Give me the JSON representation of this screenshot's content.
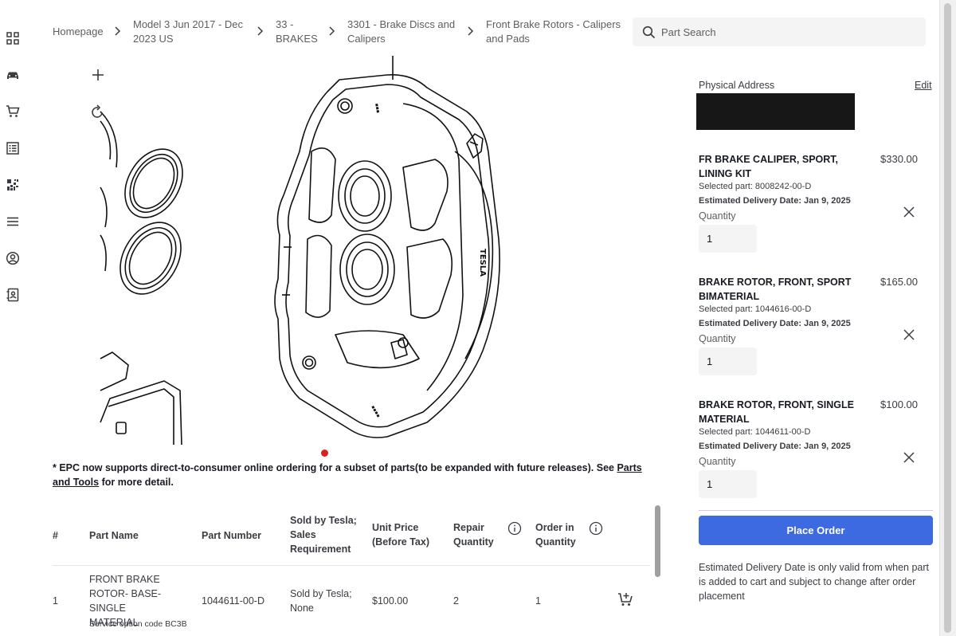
{
  "rail": {
    "items": [
      "grid-icon",
      "car-icon",
      "cart-icon",
      "catalog-icon",
      "qr-code-icon",
      "menu-icon",
      "account-icon",
      "contacts-icon"
    ]
  },
  "breadcrumb": {
    "items": [
      {
        "label": "Homepage"
      },
      {
        "label": "Model 3 Jun 2017 - Dec 2023 US"
      },
      {
        "label": "33 - BRAKES"
      },
      {
        "label": "3301 - Brake Discs and Calipers"
      },
      {
        "label": "Front Brake Rotors - Calipers and Pads"
      }
    ]
  },
  "search": {
    "placeholder": "Part Search"
  },
  "diagram": {
    "brand_mark": "TESLA"
  },
  "epc_note": {
    "text": "* EPC now supports direct-to-consumer online ordering for a subset of parts(to be expanded with future releases). See ",
    "link": "Parts and Tools",
    "suffix": " for more detail."
  },
  "table": {
    "headers": [
      "#",
      "Part Name",
      "Part Number",
      "Sold by Tesla; Sales Requirement",
      "Unit Price (Before Tax)",
      "Repair Quantity",
      "Order in Quantity"
    ],
    "rows": [
      {
        "index": "1",
        "part_name": "FRONT BRAKE ROTOR- BASE- SINGLE MATERIAL",
        "service_code": "Service option code BC3B",
        "part_number": "1044611-00-D",
        "sold_by": "Sold by Tesla; None",
        "unit_price": "$100.00",
        "repair_qty": "2",
        "order_qty": "1"
      }
    ]
  },
  "cart": {
    "physical_address_label": "Physical Address",
    "edit_label": "Edit",
    "quantity_label": "Quantity",
    "items": [
      {
        "name": "FR BRAKE CALIPER, SPORT, LINING KIT",
        "price": "$330.00",
        "selected": "Selected part: 8008242-00-D",
        "est": "Estimated Delivery Date: Jan 9, 2025",
        "qty": "1"
      },
      {
        "name": "BRAKE ROTOR, FRONT, SPORT BIMATERIAL",
        "price": "$165.00",
        "selected": "Selected part: 1044616-00-D",
        "est": "Estimated Delivery Date: Jan 9, 2025",
        "qty": "1"
      },
      {
        "name": "BRAKE ROTOR, FRONT, SINGLE MATERIAL",
        "price": "$100.00",
        "selected": "Selected part: 1044611-00-D",
        "est": "Estimated Delivery Date: Jan 9, 2025",
        "qty": "1"
      }
    ],
    "place_order_label": "Place Order",
    "delivery_note": "Estimated Delivery Date is only valid from when part is added to cart and subject to change after order placement"
  },
  "colors": {
    "primary": "#3e6ae1",
    "text": "#393c41",
    "hotspot": "#e01e1e",
    "redacted": "#171717"
  }
}
